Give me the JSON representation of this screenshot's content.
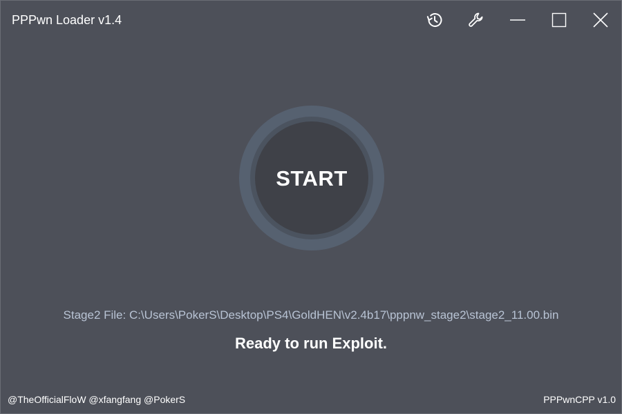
{
  "window": {
    "title": "PPPwn Loader v1.4"
  },
  "titlebar": {
    "buttons": [
      {
        "name": "history",
        "icon": "history-icon"
      },
      {
        "name": "settings",
        "icon": "wrench-icon"
      },
      {
        "name": "minimize",
        "icon": "minimize-icon"
      },
      {
        "name": "maximize",
        "icon": "maximize-icon"
      },
      {
        "name": "close",
        "icon": "close-icon"
      }
    ]
  },
  "main": {
    "start_label": "START",
    "stage_file": "Stage2 File: C:\\Users\\PokerS\\Desktop\\PS4\\GoldHEN\\v2.4b17\\pppnw_stage2\\stage2_11.00.bin",
    "status": "Ready to run Exploit."
  },
  "footer": {
    "credits": "@TheOfficialFloW @xfangfang @PokerS",
    "version": "PPPwnCPP v1.0"
  },
  "colors": {
    "background": "#4d5059",
    "start_outer_ring": "#566170",
    "start_button": "#3f4148",
    "stage_file_text": "#b8c3d4"
  }
}
